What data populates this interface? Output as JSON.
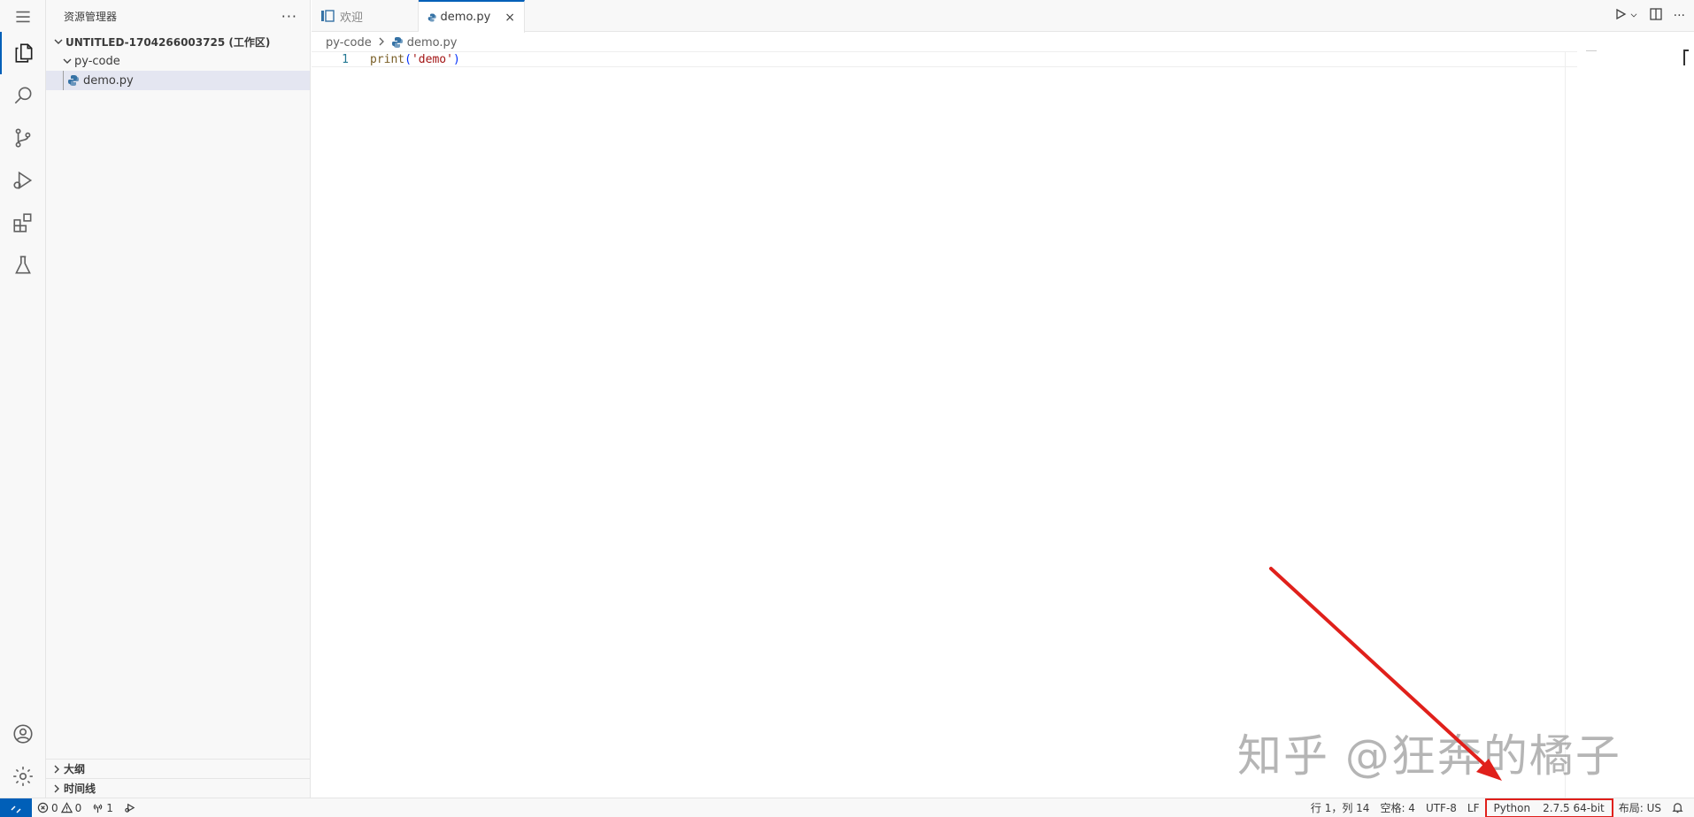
{
  "sidebar": {
    "title": "资源管理器",
    "more": "···",
    "workspace": "UNTITLED-1704266003725 (工作区)",
    "folder": "py-code",
    "file": "demo.py",
    "outline": "大纲",
    "timeline": "时间线"
  },
  "tabs": [
    {
      "label": "欢迎",
      "active": false
    },
    {
      "label": "demo.py",
      "active": true
    }
  ],
  "tab_close": "×",
  "breadcrumb": {
    "folder": "py-code",
    "file": "demo.py"
  },
  "editor": {
    "line_number": "1",
    "code_fn": "print",
    "code_open": "(",
    "code_str": "'demo'",
    "code_close": ")"
  },
  "statusbar": {
    "errors": "0",
    "warnings": "0",
    "ports": "1",
    "position": "行 1，列 14",
    "spaces": "空格: 4",
    "encoding": "UTF-8",
    "eol": "LF",
    "language": "Python",
    "interpreter": "2.7.5 64-bit",
    "layout": "布局: US"
  },
  "watermark": "知乎 @狂奔的橘子",
  "colors": {
    "accent": "#005fb8",
    "highlight_box": "#e0201b",
    "arrow": "#e0201b"
  }
}
